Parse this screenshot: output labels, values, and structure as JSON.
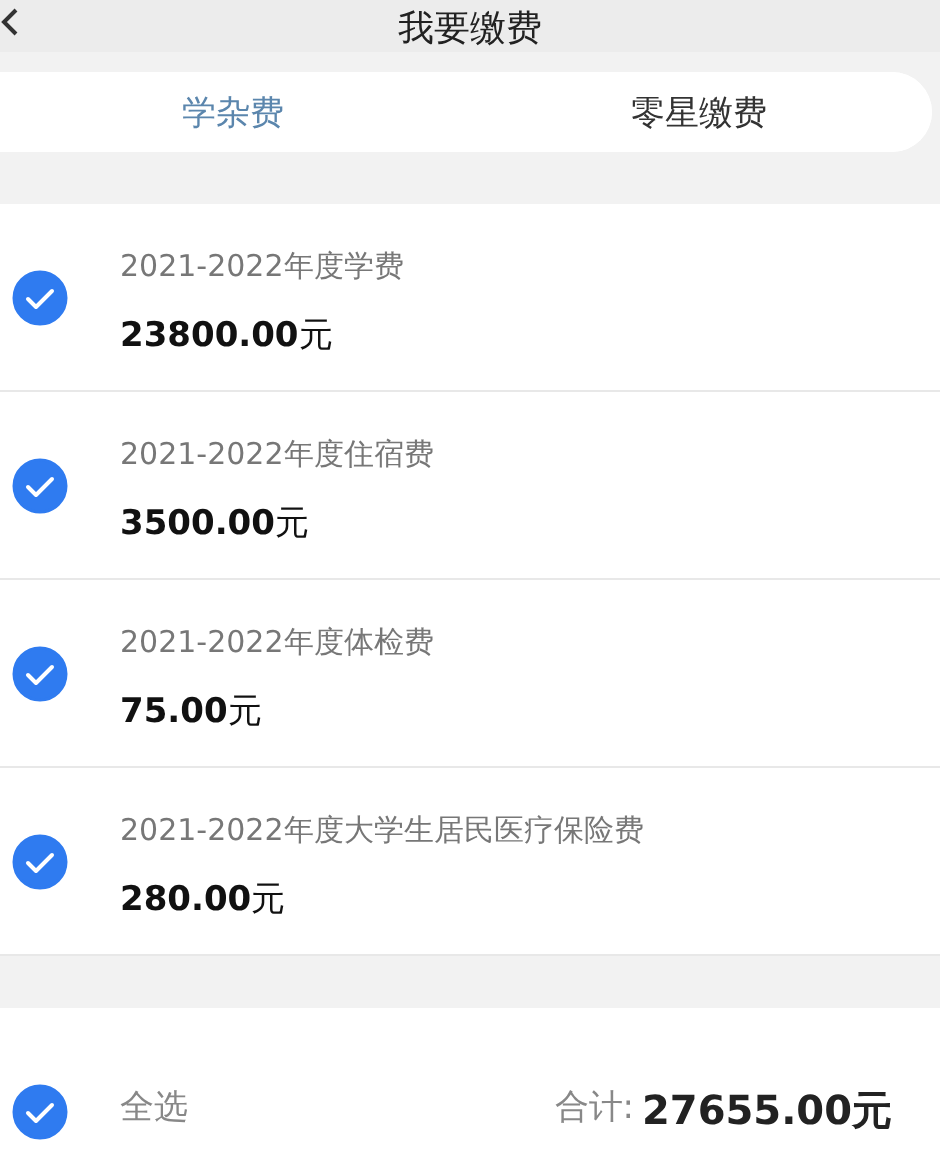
{
  "header": {
    "title": "我要缴费"
  },
  "tabs": [
    {
      "label": "学杂费",
      "selected": true
    },
    {
      "label": "零星缴费",
      "selected": false
    }
  ],
  "fees": [
    {
      "name": "2021-2022年度学费",
      "amount": "**23800.00**元",
      "checked": true
    },
    {
      "name": "2021-2022年度住宿费",
      "amount": "**3500.00**元",
      "checked": true
    },
    {
      "name": "2021-2022年度体检费",
      "amount": "**75.00**元",
      "checked": true
    },
    {
      "name": "2021-2022年度大学生居民医疗保险费",
      "amount": "**280.00**元",
      "checked": true
    }
  ],
  "footer": {
    "select_all": {
      "label": "全选",
      "checked": true
    },
    "total_label": "合计:",
    "total": "27655.00元"
  }
}
